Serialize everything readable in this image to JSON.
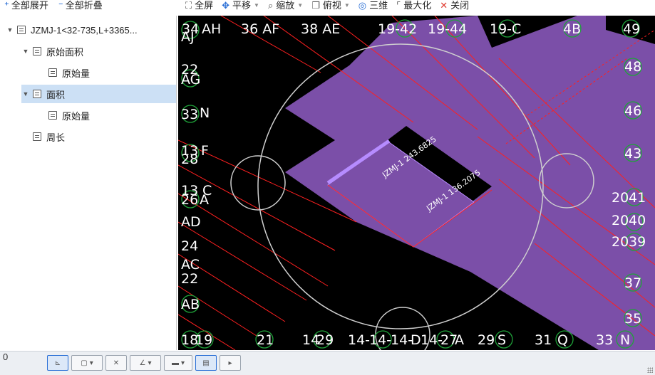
{
  "left_toolbar": {
    "expand_all": "全部展开",
    "collapse_all": "全部折叠",
    "expand_icon": "plus-icon",
    "collapse_icon": "minus-icon"
  },
  "tree": {
    "items": [
      {
        "label": "JZMJ-1<32-735,L+3365...",
        "level": 0,
        "expanded": true,
        "selected": false
      },
      {
        "label": "原始面积",
        "level": 1,
        "expanded": true,
        "selected": false
      },
      {
        "label": "原始量",
        "level": 2,
        "expanded": false,
        "selected": false
      },
      {
        "label": "面积",
        "level": 1,
        "expanded": true,
        "selected": true
      },
      {
        "label": "原始量",
        "level": 2,
        "expanded": false,
        "selected": false
      },
      {
        "label": "周长",
        "level": 1,
        "expanded": false,
        "selected": false
      }
    ]
  },
  "view_toolbar": {
    "fullscreen": "全屏",
    "pan": "平移",
    "zoom": "缩放",
    "top_view": "俯视",
    "three_d": "三维",
    "maximize": "最大化",
    "close": "关闭"
  },
  "viewport": {
    "area_colors": {
      "region": "#7b4fa8",
      "boundary": "#ff2020",
      "circle": "#cfcfcf",
      "axis_marker": "#1fa33a"
    },
    "dimension_labels": [
      "JZMJ-1 243.6825",
      "JZMJ-1 136.2075"
    ],
    "axis_labels": {
      "top": [
        "34",
        "AH",
        "36 AF",
        "38 AE",
        "19-42",
        "19-44",
        "19-C",
        "4B",
        "49"
      ],
      "left": [
        "AJ",
        "22",
        "AG",
        "33",
        "N",
        "13",
        "F",
        "28",
        "13",
        "C",
        "26",
        "A",
        "AD",
        "24",
        "AC",
        "22",
        "AB"
      ],
      "right": [
        "48",
        "46",
        "43",
        "20",
        "41",
        "20",
        "40",
        "20",
        "39",
        "37",
        "35"
      ],
      "bottom": [
        "18",
        "19",
        "21",
        "14",
        "29",
        "14-",
        "14-",
        "14-",
        "D",
        "14-",
        "27",
        "A",
        "29",
        "S",
        "31",
        "Q",
        "33",
        "N"
      ]
    }
  },
  "status_bar": {
    "left_value": "0"
  }
}
